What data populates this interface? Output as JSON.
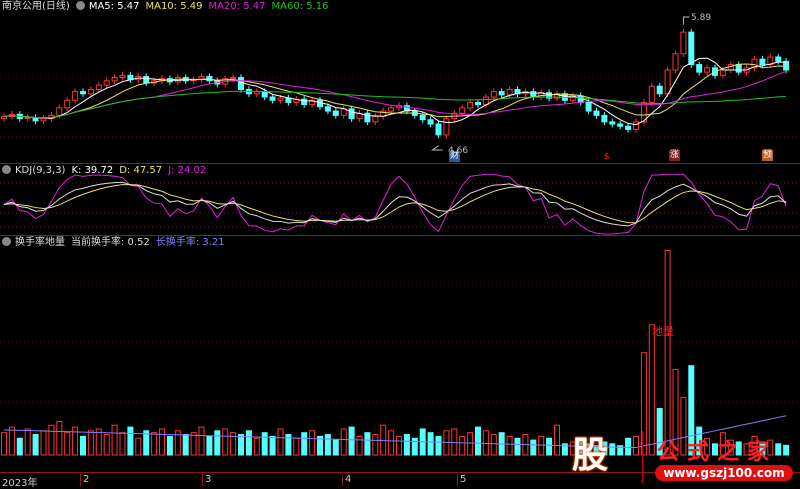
{
  "header": {
    "title": "南京公用(日线)",
    "ma5": "MA5: 5.47",
    "ma10": "MA10: 5.49",
    "ma20": "MA20: 5.47",
    "ma60": "MA60: 5.16"
  },
  "kdj": {
    "title": "KDJ(9,3,3)",
    "k": "K: 39.72",
    "d": "D: 47.57",
    "j": "J: 24.02"
  },
  "turnover": {
    "title": "换手率地量",
    "current": "当前换手率: 0.52",
    "long": "长换手率: 3.21",
    "low_label": "地量"
  },
  "markers": {
    "low": "4.66",
    "high": "5.89",
    "cai": "财",
    "dollar": "$",
    "zhang": "涨",
    "yu": "预"
  },
  "axis": [
    "2023年",
    "2",
    "3",
    "4",
    "5"
  ],
  "watermark": {
    "logo": "股",
    "name": "公式之家",
    "url": "www.gszj100.com"
  },
  "colors": {
    "up": "#ff3232",
    "down": "#54ffff",
    "ma5": "#ffffff",
    "ma10": "#e8e06a",
    "ma20": "#e020e0",
    "ma60": "#20c020",
    "longline": "#8080ff"
  },
  "chart_data": {
    "type": "candlestick",
    "price_range": [
      4.66,
      5.89
    ],
    "closes": [
      4.97,
      4.99,
      4.95,
      4.96,
      4.93,
      4.95,
      4.98,
      5.05,
      5.12,
      5.2,
      5.18,
      5.22,
      5.26,
      5.3,
      5.33,
      5.35,
      5.31,
      5.34,
      5.28,
      5.3,
      5.32,
      5.29,
      5.33,
      5.3,
      5.31,
      5.34,
      5.3,
      5.27,
      5.32,
      5.33,
      5.22,
      5.18,
      5.2,
      5.15,
      5.12,
      5.14,
      5.1,
      5.13,
      5.08,
      5.12,
      5.06,
      5.02,
      4.98,
      5.04,
      4.95,
      5.0,
      4.92,
      4.97,
      5.02,
      5.05,
      5.07,
      5.02,
      4.98,
      4.94,
      4.9,
      4.8,
      4.95,
      5.0,
      5.05,
      5.1,
      5.08,
      5.15,
      5.2,
      5.17,
      5.22,
      5.18,
      5.2,
      5.15,
      5.19,
      5.14,
      5.18,
      5.12,
      5.16,
      5.1,
      5.02,
      4.98,
      4.92,
      4.9,
      4.88,
      4.85,
      4.92,
      5.1,
      5.25,
      5.18,
      5.4,
      5.55,
      5.75,
      5.45,
      5.38,
      5.42,
      5.35,
      5.4,
      5.45,
      5.38,
      5.42,
      5.5,
      5.45,
      5.52,
      5.48,
      5.4
    ],
    "turnover": [
      1.2,
      1.5,
      0.9,
      1.4,
      1.1,
      1.3,
      1.6,
      1.8,
      1.2,
      1.5,
      1.0,
      1.3,
      1.4,
      1.1,
      1.6,
      1.2,
      1.5,
      0.9,
      1.3,
      1.2,
      1.4,
      1.0,
      1.3,
      1.1,
      1.2,
      1.5,
      1.0,
      1.3,
      1.4,
      1.2,
      1.1,
      1.3,
      0.9,
      1.2,
      1.0,
      1.4,
      1.1,
      0.9,
      1.2,
      1.3,
      1.0,
      1.1,
      0.8,
      1.4,
      1.5,
      1.0,
      1.2,
      1.1,
      1.6,
      1.3,
      1.0,
      1.1,
      0.9,
      1.4,
      1.2,
      1.0,
      1.3,
      1.4,
      1.0,
      1.2,
      1.5,
      1.3,
      1.1,
      1.2,
      1.0,
      0.9,
      1.1,
      0.8,
      1.0,
      0.9,
      1.6,
      0.6,
      0.7,
      0.8,
      0.6,
      0.5,
      0.7,
      0.6,
      0.5,
      0.9,
      1.0,
      5.5,
      7.0,
      2.5,
      11.0,
      4.6,
      3.1,
      4.8,
      1.5,
      0.9,
      0.6,
      1.2,
      0.8,
      0.7,
      0.6,
      1.0,
      0.7,
      0.8,
      0.6,
      0.52
    ],
    "kdj_range": [
      0,
      100
    ]
  }
}
